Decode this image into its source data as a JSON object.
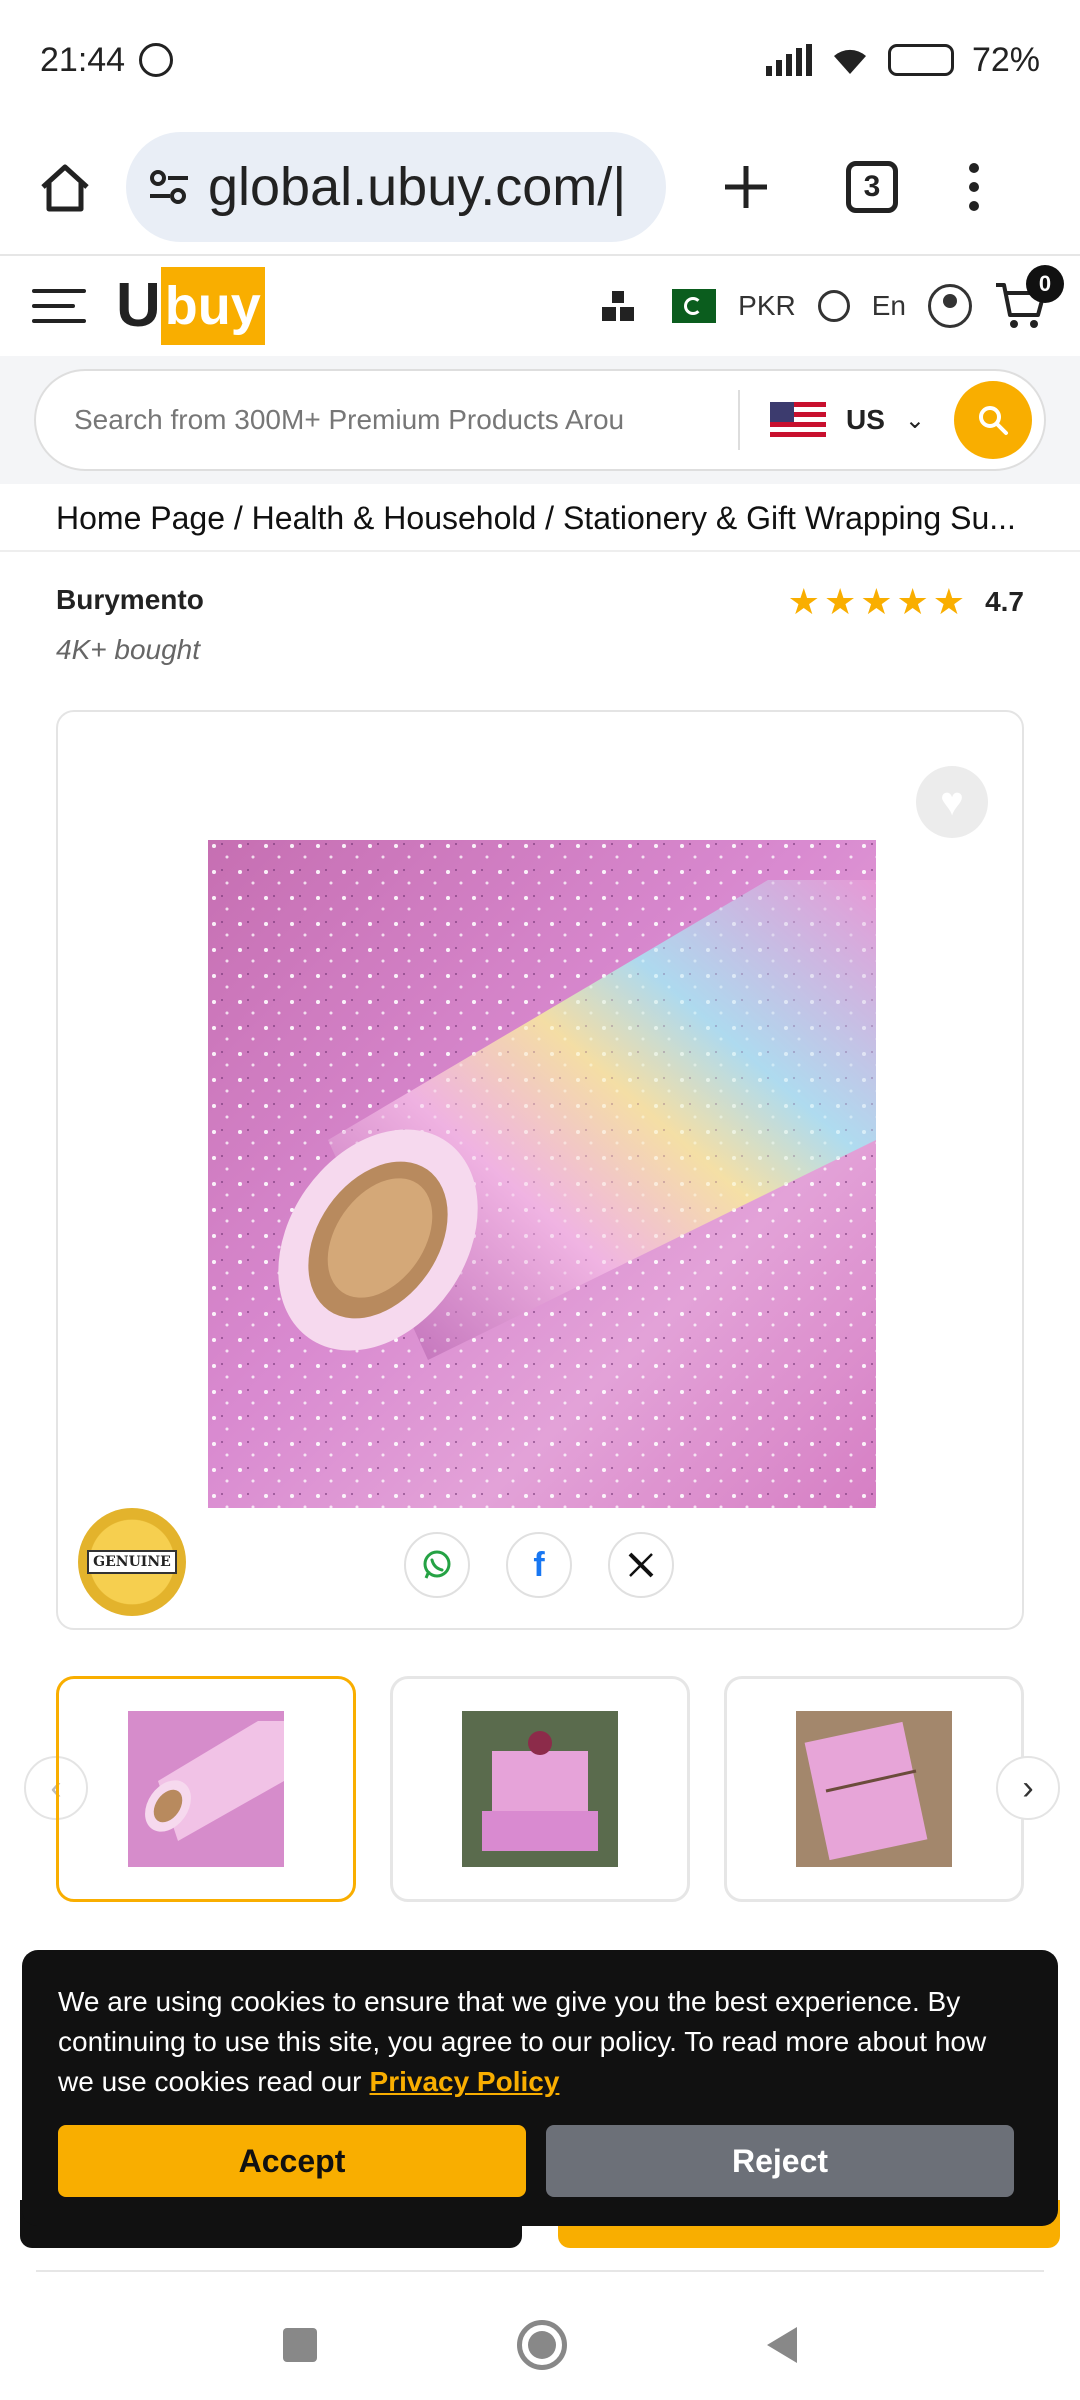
{
  "status_bar": {
    "time": "21:44",
    "battery": "72%"
  },
  "browser": {
    "url": "global.ubuy.com/|",
    "tab_count": "3"
  },
  "site_header": {
    "logo_prefix": "U",
    "logo_suffix": "buy",
    "currency": "PKR",
    "language": "En",
    "cart_count": "0"
  },
  "search": {
    "placeholder": "Search from 300M+ Premium Products Arou",
    "store_country": "US"
  },
  "breadcrumb": "Home Page / Health & Household / Stationery & Gift Wrapping Su...",
  "product": {
    "brand": "Burymento",
    "bought": "4K+ bought",
    "rating": "4.7",
    "stars": 5,
    "badge_text": "GENUINE"
  },
  "cookie": {
    "message": "We are using cookies to ensure that we give you the best experience. By continuing to use this site, you agree to our policy. To read more about how we use cookies read our",
    "link_label": "Privacy Policy",
    "accept_label": "Accept",
    "reject_label": "Reject"
  },
  "colors": {
    "brand_accent": "#f9ae00",
    "banner_bg": "#111111",
    "reject_bg": "#6c7078"
  }
}
